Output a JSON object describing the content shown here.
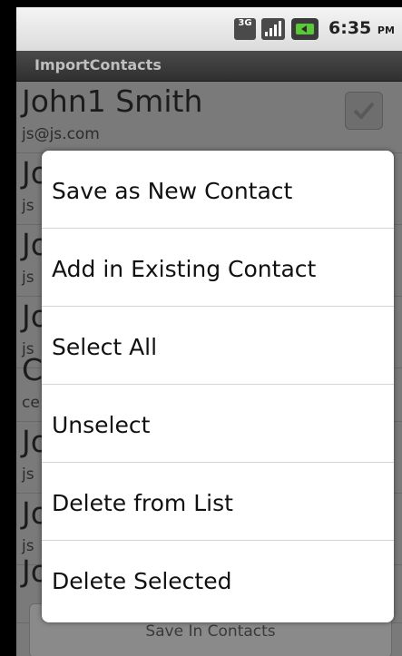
{
  "status_bar": {
    "network_label": "3G",
    "time": "6:35",
    "ampm": "PM"
  },
  "app": {
    "title": "ImportContacts"
  },
  "contacts": [
    {
      "name": "John1 Smith",
      "email": "js@js.com",
      "checked": true
    },
    {
      "name": "Jo",
      "email": "js"
    },
    {
      "name": "Jo",
      "email": "js"
    },
    {
      "name": "Jo",
      "email": "js"
    },
    {
      "name": "C",
      "email": "ce"
    },
    {
      "name": "Jo",
      "email": "js"
    },
    {
      "name": "Jo",
      "email": "js"
    },
    {
      "name": "Jo",
      "email": ""
    }
  ],
  "save_button": {
    "label": "Save In Contacts"
  },
  "context_menu": {
    "items": [
      {
        "label": "Save as New Contact"
      },
      {
        "label": "Add in Existing Contact"
      },
      {
        "label": "Select All"
      },
      {
        "label": "Unselect"
      },
      {
        "label": "Delete from List"
      },
      {
        "label": "Delete Selected"
      }
    ]
  },
  "colors": {
    "title_bar": "#3a3a3a",
    "dim_overlay": "#7a7a7a",
    "dialog_bg": "#ffffff",
    "battery_accent": "#5cc63a"
  }
}
